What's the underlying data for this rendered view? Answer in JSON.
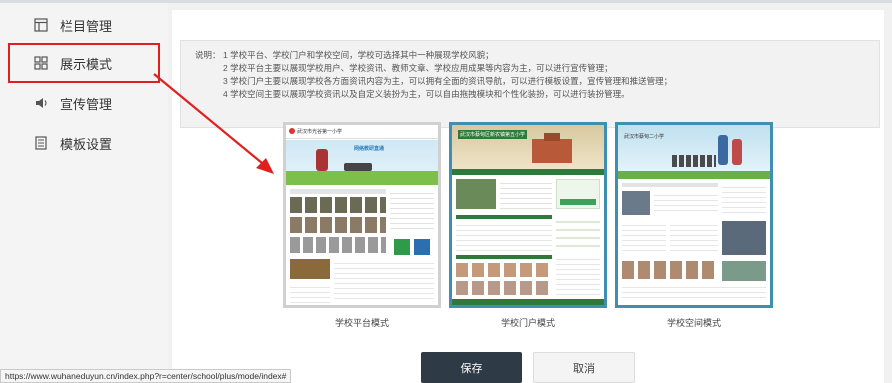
{
  "sidebar": {
    "items": [
      {
        "label": "栏目管理",
        "icon": "grid-column-icon"
      },
      {
        "label": "展示模式",
        "icon": "four-squares-icon",
        "active": true
      },
      {
        "label": "宣传管理",
        "icon": "speaker-icon"
      },
      {
        "label": "模板设置",
        "icon": "document-list-icon"
      }
    ]
  },
  "notice": {
    "label": "说明：",
    "lines": [
      "1 学校平台、学校门户和学校空间，学校可选择其中一种展现学校风貌；",
      "2 学校平台主要以展现学校用户、学校资讯、教师文章、学校应用成果等内容为主，可以进行宣传管理；",
      "3 学校门户主要以展现学校各方面资讯内容为主，可以拥有全面的资讯导航，可以进行模板设置，宣传管理和推送管理；",
      "4 学校空间主要以展现学校资讯以及自定义装扮为主，可以自由拖拽模块和个性化装扮，可以进行装扮管理。"
    ]
  },
  "modes": [
    {
      "caption": "学校平台模式",
      "site_title": "武汉市光谷第一小学",
      "banner_text": "网络教研直通",
      "selected": false
    },
    {
      "caption": "学校门户模式",
      "site_title": "武汉市蔡甸区新农镇第五小学",
      "selected": true
    },
    {
      "caption": "学校空间模式",
      "site_title": "武汉市蔡甸二小学",
      "selected": true
    }
  ],
  "buttons": {
    "save": "保存",
    "cancel": "取消"
  },
  "status_url": "https://www.wuhaneduyun.cn/index.php?r=center/school/plus/mode/index#",
  "colors": {
    "highlight": "#e0201e",
    "selected_border": "#3f8fb0",
    "save_bg": "#2e3a46"
  }
}
